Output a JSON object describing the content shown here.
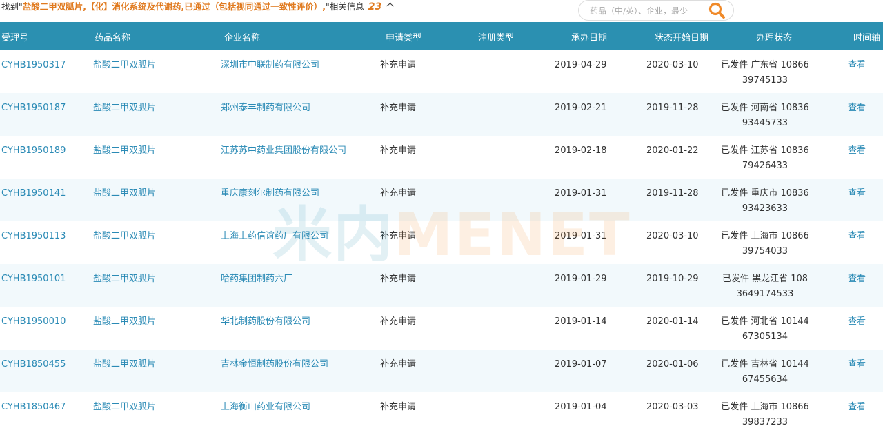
{
  "summary": {
    "prefix": "找到\"",
    "query": "盐酸二甲双胍片,【化】消化系统及代谢药,已通过（包括视同通过一致性评价）,",
    "middle": "\"相关信息",
    "count": "23",
    "suffix": "个"
  },
  "search": {
    "placeholder": "药品（中/英）、企业，最少"
  },
  "header": {
    "id": "受理号",
    "drug": "药品名称",
    "company": "企业名称",
    "apply_type": "申请类型",
    "reg_type": "注册类型",
    "undertake_date": "承办日期",
    "status_start": "状态开始日期",
    "status": "办理状态",
    "timeline": "时间轴"
  },
  "watermark": {
    "part1": "米内",
    "part2": "MENET"
  },
  "rows": [
    {
      "id": "CYHB1950317",
      "drug": "盐酸二甲双胍片",
      "company": "深圳市中联制药有限公司",
      "apply_type": "补充申请",
      "reg_type": "",
      "undertake_date": "2019-04-29",
      "status_start": "2020-03-10",
      "status": "已发件 广东省 10866 39745133",
      "view": "查看"
    },
    {
      "id": "CYHB1950187",
      "drug": "盐酸二甲双胍片",
      "company": "郑州泰丰制药有限公司",
      "apply_type": "补充申请",
      "reg_type": "",
      "undertake_date": "2019-02-21",
      "status_start": "2019-11-28",
      "status": "已发件 河南省 10836 93445733",
      "view": "查看"
    },
    {
      "id": "CYHB1950189",
      "drug": "盐酸二甲双胍片",
      "company": "江苏苏中药业集团股份有限公司",
      "apply_type": "补充申请",
      "reg_type": "",
      "undertake_date": "2019-02-18",
      "status_start": "2020-01-22",
      "status": "已发件 江苏省 10836 79426433",
      "view": "查看"
    },
    {
      "id": "CYHB1950141",
      "drug": "盐酸二甲双胍片",
      "company": "重庆康刻尔制药有限公司",
      "apply_type": "补充申请",
      "reg_type": "",
      "undertake_date": "2019-01-31",
      "status_start": "2019-11-28",
      "status": "已发件 重庆市 10836 93423633",
      "view": "查看"
    },
    {
      "id": "CYHB1950113",
      "drug": "盐酸二甲双胍片",
      "company": "上海上药信谊药厂有限公司",
      "apply_type": "补充申请",
      "reg_type": "",
      "undertake_date": "2019-01-31",
      "status_start": "2020-03-10",
      "status": "已发件 上海市 10866 39754033",
      "view": "查看"
    },
    {
      "id": "CYHB1950101",
      "drug": "盐酸二甲双胍片",
      "company": "哈药集团制药六厂",
      "apply_type": "补充申请",
      "reg_type": "",
      "undertake_date": "2019-01-29",
      "status_start": "2019-10-29",
      "status": "已发件 黑龙江省 108 3649174533",
      "view": "查看"
    },
    {
      "id": "CYHB1950010",
      "drug": "盐酸二甲双胍片",
      "company": "华北制药股份有限公司",
      "apply_type": "补充申请",
      "reg_type": "",
      "undertake_date": "2019-01-14",
      "status_start": "2020-01-14",
      "status": "已发件 河北省 10144 67305134",
      "view": "查看"
    },
    {
      "id": "CYHB1850455",
      "drug": "盐酸二甲双胍片",
      "company": "吉林金恒制药股份有限公司",
      "apply_type": "补充申请",
      "reg_type": "",
      "undertake_date": "2019-01-07",
      "status_start": "2020-01-06",
      "status": "已发件 吉林省 10144 67455634",
      "view": "查看"
    },
    {
      "id": "CYHB1850467",
      "drug": "盐酸二甲双胍片",
      "company": "上海衡山药业有限公司",
      "apply_type": "补充申请",
      "reg_type": "",
      "undertake_date": "2019-01-04",
      "status_start": "2020-03-03",
      "status": "已发件 上海市 10866 39837233",
      "view": "查看"
    }
  ]
}
